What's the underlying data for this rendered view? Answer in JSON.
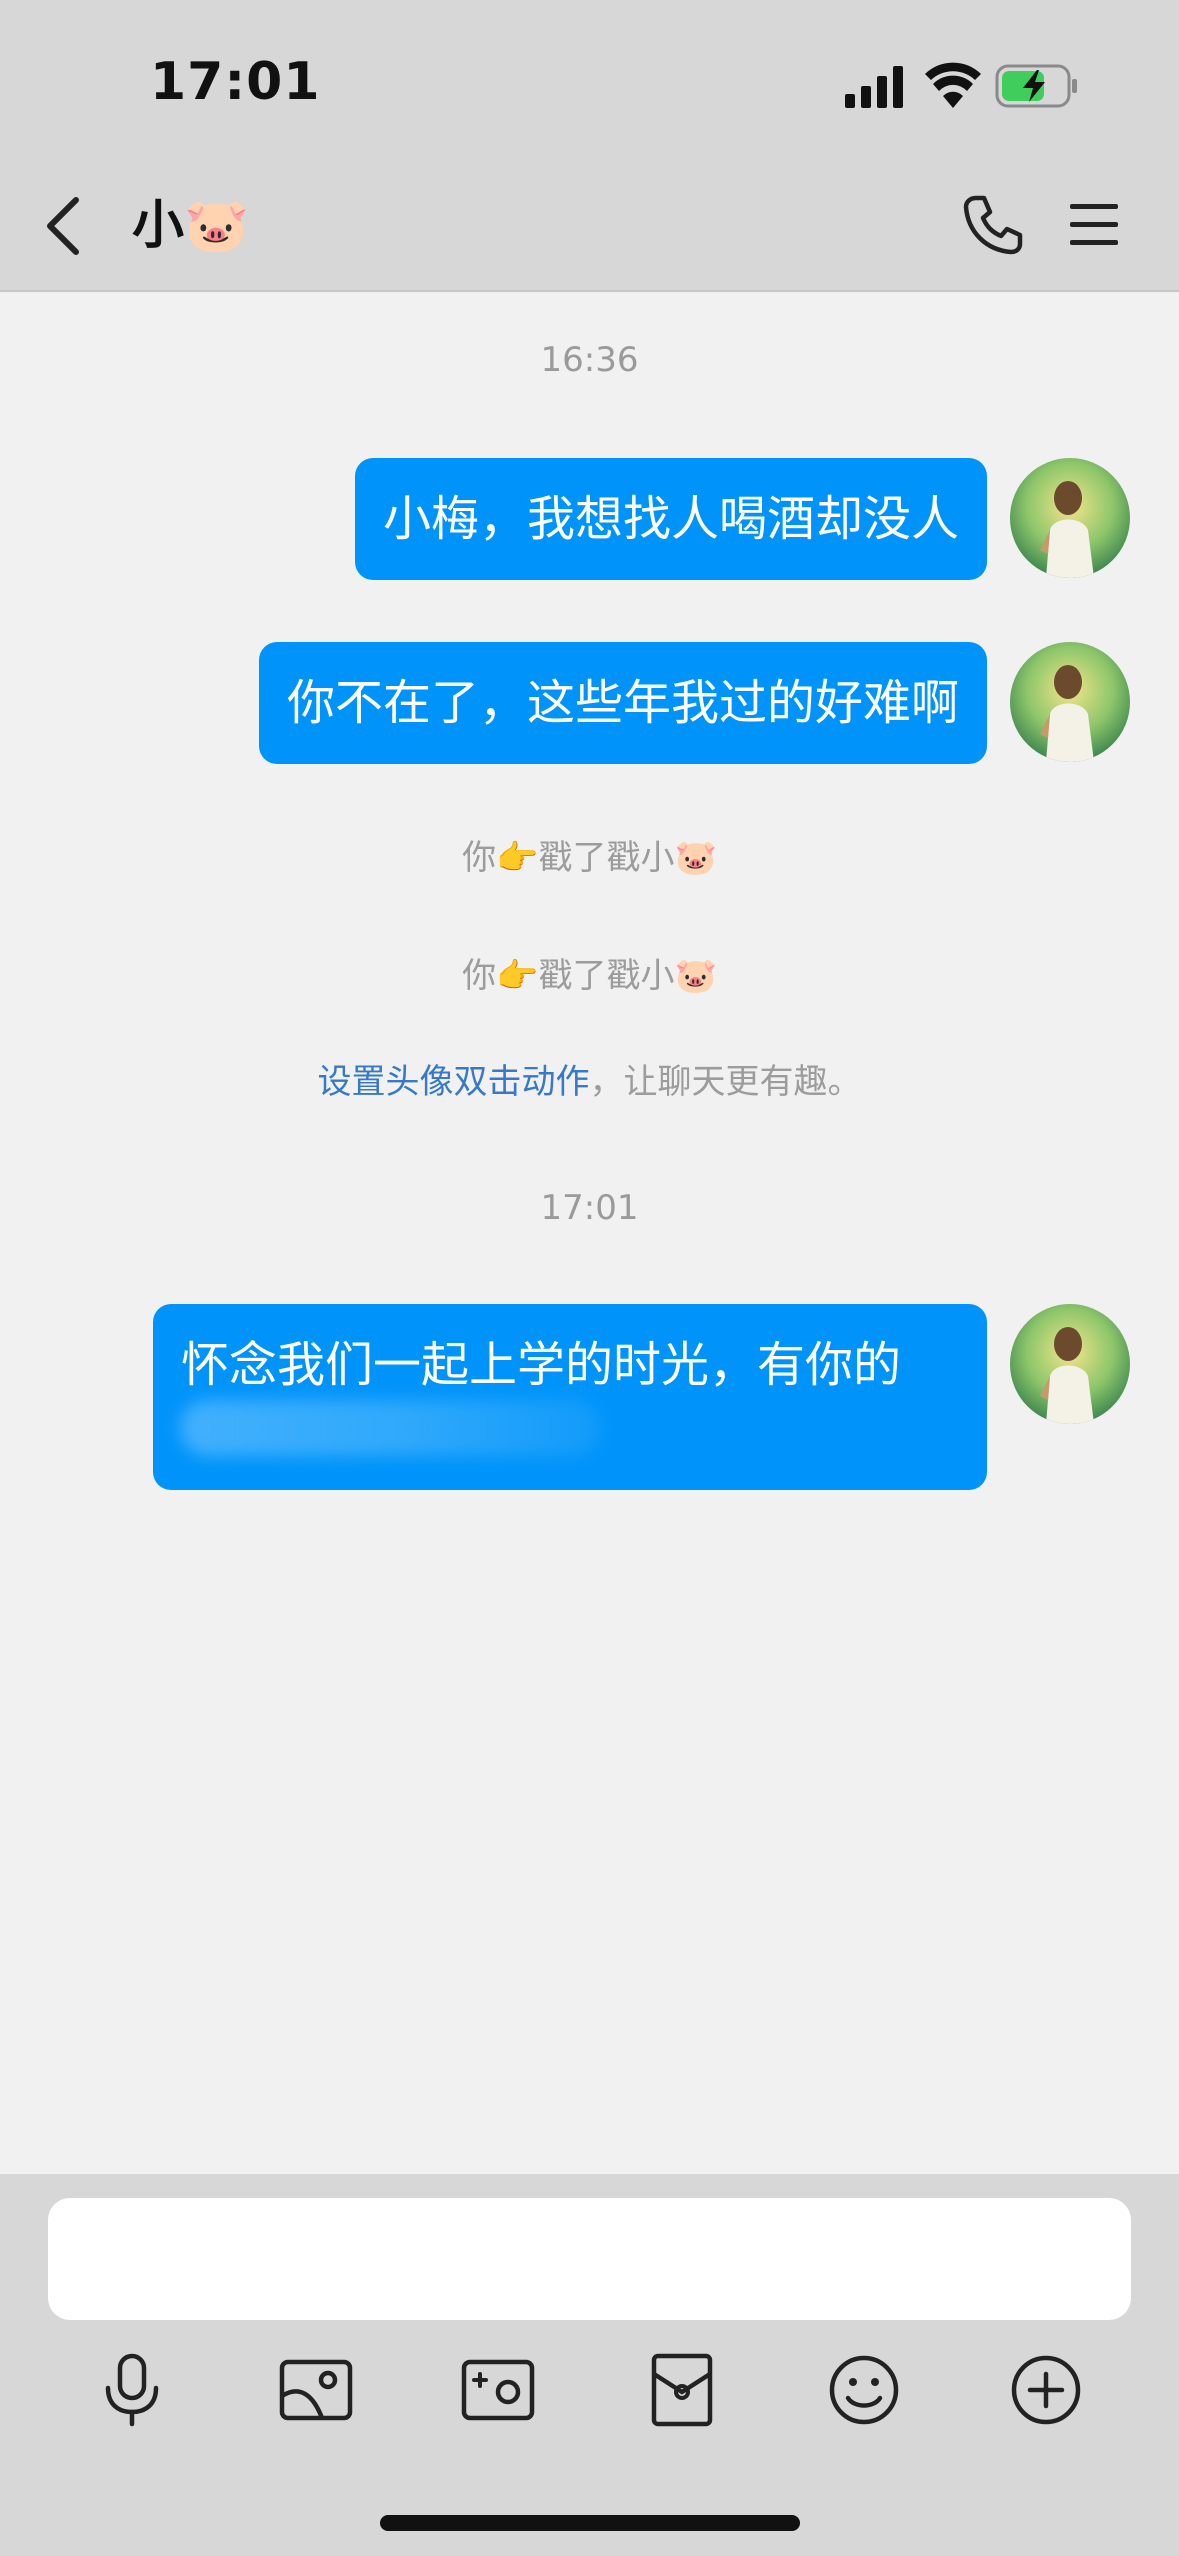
{
  "status_bar": {
    "time": "17:01"
  },
  "header": {
    "title": "小🐷"
  },
  "messages": {
    "timestamp_1": "16:36",
    "msg_1": "小梅，我想找人喝酒却没人",
    "msg_2": "你不在了，这些年我过的好难啊",
    "nudge_1": "你👉戳了戳小🐷",
    "nudge_2": "你👉戳了戳小🐷",
    "hint_link": "设置头像双击动作",
    "hint_rest": "，让聊天更有趣。",
    "timestamp_2": "17:01",
    "msg_3": "怀念我们一起上学的时光，有你的"
  },
  "input": {
    "value": ""
  },
  "toolbar": {
    "icons": [
      "microphone-icon",
      "image-icon",
      "camera-icon",
      "red-packet-icon",
      "emoji-icon",
      "plus-icon"
    ]
  },
  "colors": {
    "bubble": "#0094fa",
    "background": "#f1f1f1",
    "bar": "#d7d7d7",
    "link": "#3779c8"
  }
}
